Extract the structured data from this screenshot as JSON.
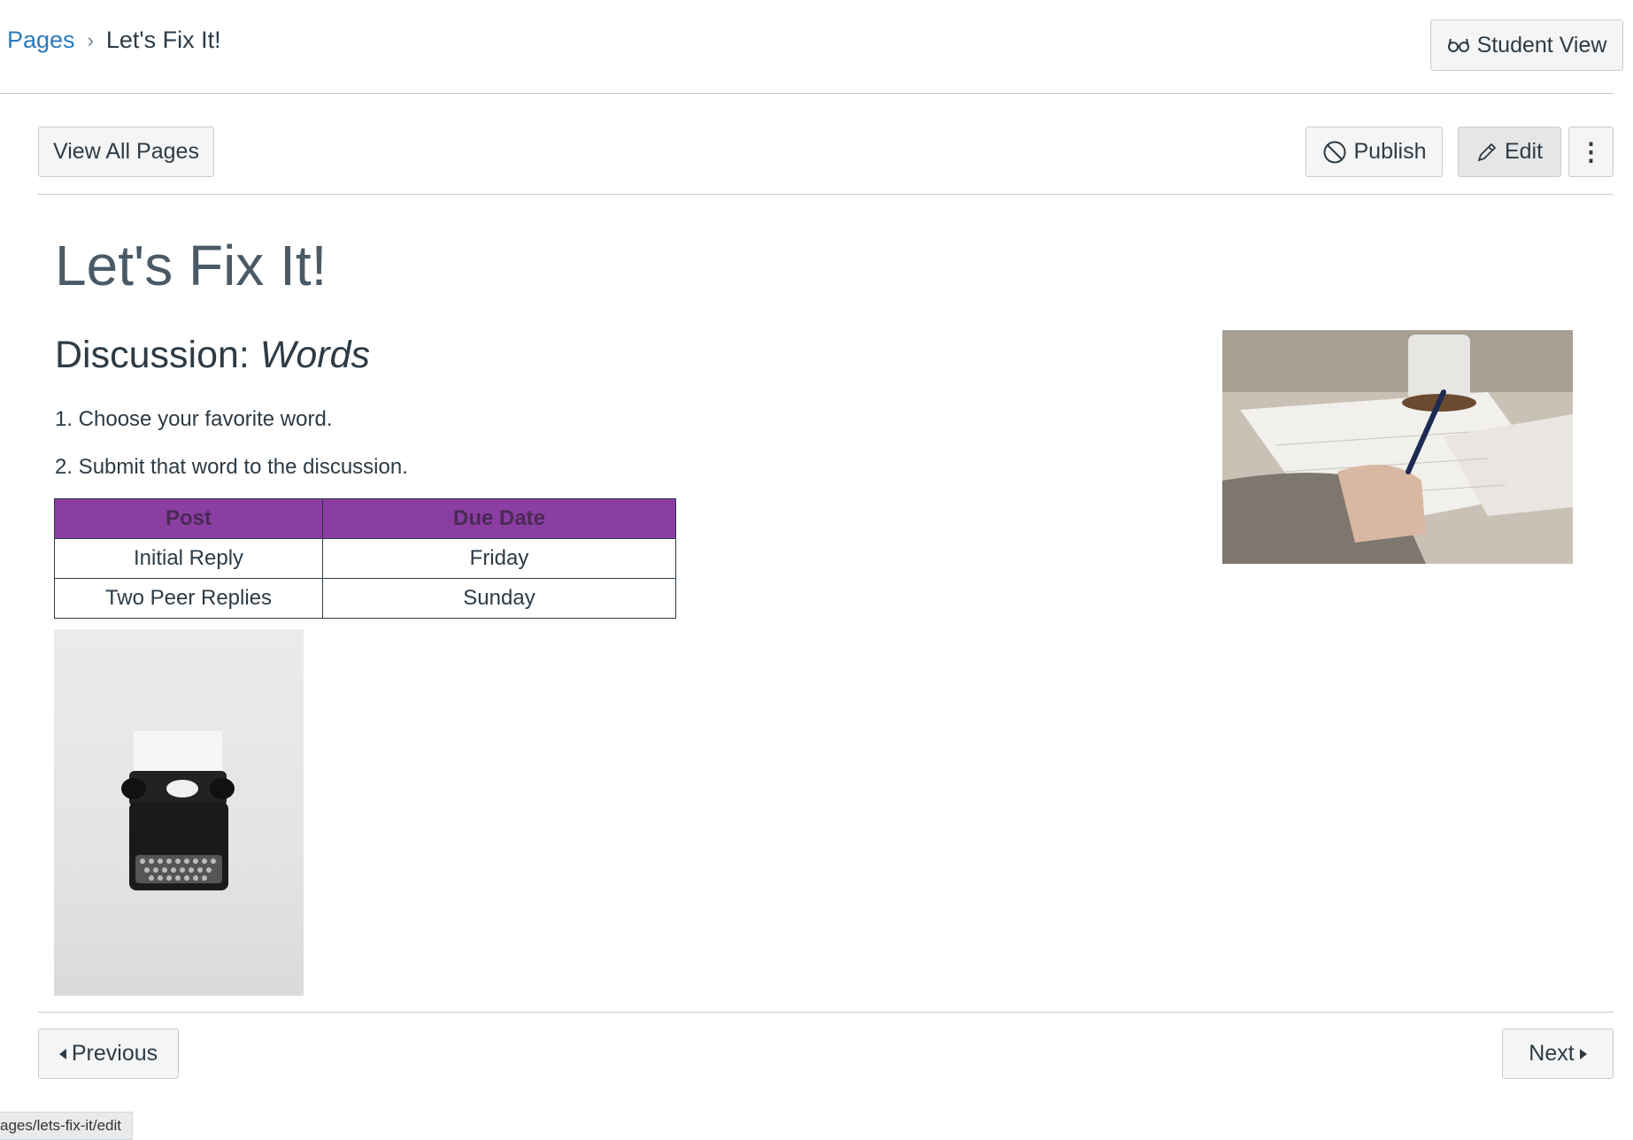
{
  "breadcrumb": {
    "pages_label": "Pages",
    "separator": "›",
    "current_label": "Let's Fix It!"
  },
  "header": {
    "student_view_label": "Student View"
  },
  "toolbar": {
    "view_all_label": "View All Pages",
    "publish_label": "Publish",
    "edit_label": "Edit",
    "more_label": "⋮"
  },
  "content": {
    "title": "Let's Fix It!",
    "heading_prefix": "Discussion: ",
    "heading_emph": "Words",
    "steps": [
      "1. Choose your favorite word.",
      "2. Submit that word to the discussion."
    ],
    "table": {
      "headers": [
        "Post",
        "Due Date"
      ],
      "rows": [
        [
          "Initial Reply",
          "Friday"
        ],
        [
          "Two Peer Replies",
          "Sunday"
        ]
      ]
    }
  },
  "footer": {
    "previous_label": "Previous",
    "next_label": "Next"
  },
  "status_bar": {
    "url": "ages/lets-fix-it/edit"
  },
  "colors": {
    "link": "#2b7abc",
    "table_header": "#8a3ea1",
    "text": "#2d3b45",
    "button_bg": "#f5f5f5",
    "edit_bg": "#e6e6e6"
  },
  "icons": {
    "student_view": "glasses-icon",
    "publish": "unpublished-icon",
    "edit": "pencil-icon",
    "more": "kebab-icon",
    "previous": "caret-left-icon",
    "next": "caret-right-icon"
  }
}
